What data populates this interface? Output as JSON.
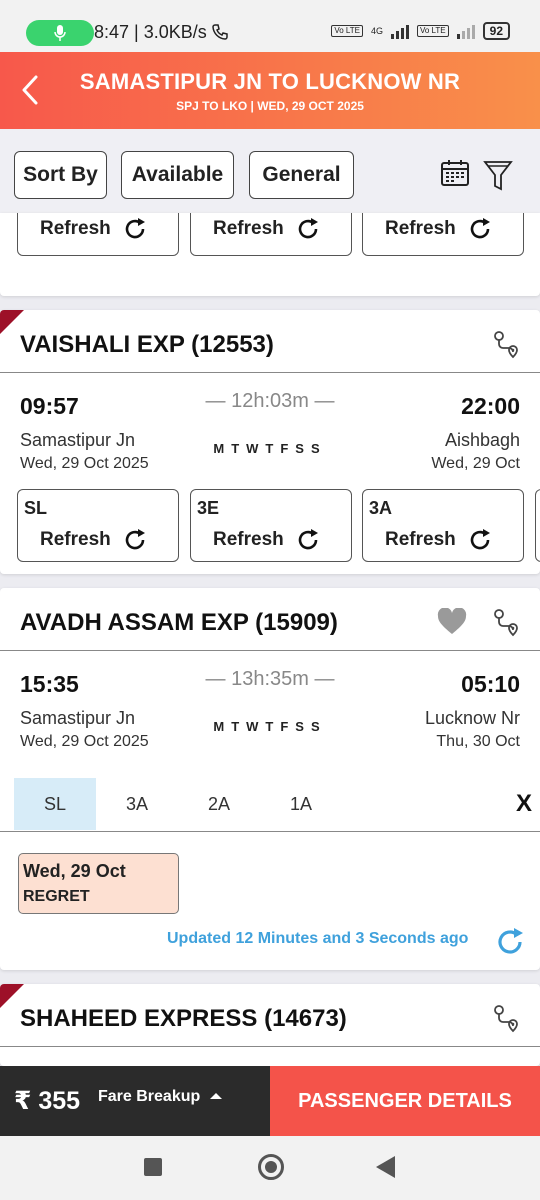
{
  "status": {
    "time_speed": "8:47 | 3.0KB/s",
    "volte1": "Vo LTE",
    "net": "4G",
    "volte2": "Vo LTE",
    "battery": "92"
  },
  "header": {
    "title": "SAMASTIPUR JN TO LUCKNOW NR",
    "subtitle": "SPJ TO LKO | WED, 29 OCT  2025"
  },
  "filters": {
    "sort_by": "Sort By",
    "available": "Available",
    "general": "General"
  },
  "top_partial": {
    "refresh": [
      "Refresh",
      "Refresh",
      "Refresh"
    ]
  },
  "trains": [
    {
      "name": "VAISHALI EXP",
      "number": "(12553)",
      "depart_time": "09:57",
      "duration": "— 12h:03m —",
      "arrive_time": "22:00",
      "from_station": "Samastipur Jn",
      "from_date": "Wed, 29 Oct  2025",
      "days": "MTWTFSS",
      "to_station": "Aishbagh",
      "to_date": "Wed, 29 Oct",
      "classes": [
        {
          "label": "SL",
          "action": "Refresh"
        },
        {
          "label": "3E",
          "action": "Refresh"
        },
        {
          "label": "3A",
          "action": "Refresh"
        }
      ]
    },
    {
      "name": "AVADH ASSAM EXP",
      "number": "(15909)",
      "depart_time": "15:35",
      "duration": "— 13h:35m —",
      "arrive_time": "05:10",
      "from_station": "Samastipur Jn",
      "from_date": "Wed, 29 Oct  2025",
      "days": "MTWTFSS",
      "to_station": "Lucknow Nr",
      "to_date": "Thu, 30 Oct",
      "tabs": [
        "SL",
        "3A",
        "2A",
        "1A"
      ],
      "close": "X",
      "availability": {
        "date": "Wed, 29 Oct",
        "status": "REGRET"
      },
      "updated": "Updated 12 Minutes and 3 Seconds ago"
    },
    {
      "name": "SHAHEED EXPRESS",
      "number": "(14673)"
    }
  ],
  "bottom": {
    "fare": "₹ 355",
    "fare_breakup": "Fare Breakup",
    "passenger_details": "PASSENGER DETAILS"
  },
  "colors": {
    "header_start": "#f7584b",
    "header_end": "#f9904a",
    "accent_blue": "#3fa1dc",
    "cta_red": "#f4534a",
    "corner_red": "#9d1028"
  }
}
